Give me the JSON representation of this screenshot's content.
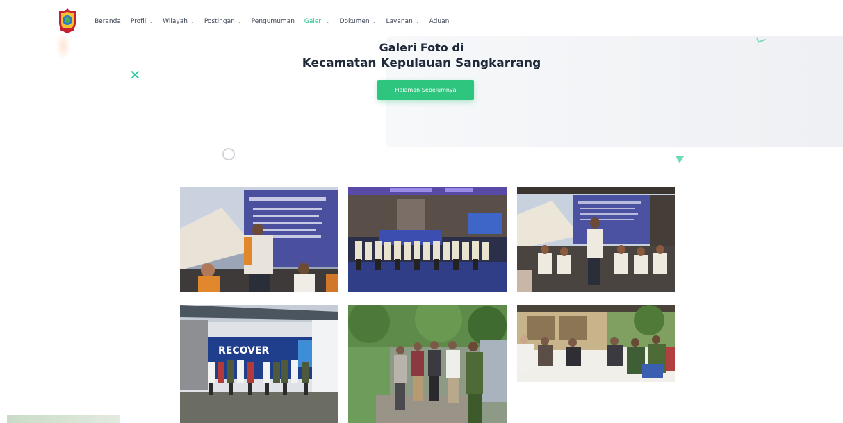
{
  "nav": {
    "items": [
      {
        "label": "Beranda",
        "caret": false,
        "active": false
      },
      {
        "label": "Profil",
        "caret": true,
        "active": false
      },
      {
        "label": "Wilayah",
        "caret": true,
        "active": false
      },
      {
        "label": "Postingan",
        "caret": true,
        "active": false
      },
      {
        "label": "Pengumuman",
        "caret": false,
        "active": false
      },
      {
        "label": "Galeri",
        "caret": true,
        "active": true
      },
      {
        "label": "Dokumen",
        "caret": true,
        "active": false
      },
      {
        "label": "Layanan",
        "caret": true,
        "active": false
      },
      {
        "label": "Aduan",
        "caret": false,
        "active": false
      }
    ]
  },
  "hero": {
    "title_line1": "Galeri Foto di",
    "title_line2": "Kecamatan Kepulauan Sangkarrang",
    "back_button": "Halaman Sebelumnya"
  },
  "gallery": {
    "photos": [
      {
        "name": "photo-speaker-stage"
      },
      {
        "name": "photo-group-on-stage"
      },
      {
        "name": "photo-speaker-audience"
      },
      {
        "name": "photo-recover-banner-group"
      },
      {
        "name": "photo-outdoor-visit"
      },
      {
        "name": "photo-house-meeting"
      }
    ],
    "banner_text": "RECOVER"
  },
  "colors": {
    "accent": "#2ec67f",
    "nav_active": "#22c28a",
    "title": "#1e2a3a"
  }
}
